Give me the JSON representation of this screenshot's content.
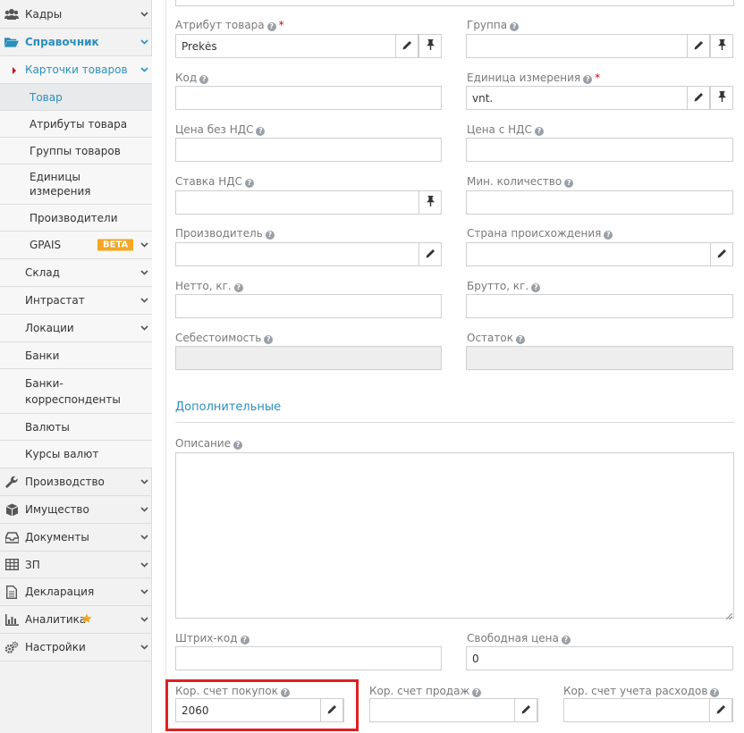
{
  "sidebar": {
    "sections": [
      {
        "label": "Кадры",
        "icon": "users-icon"
      },
      {
        "label": "Справочник",
        "icon": "folder-open-icon"
      },
      {
        "label": "Карточки товаров"
      },
      {
        "label": "Товар"
      },
      {
        "label": "Атрибуты товара"
      },
      {
        "label": "Группы товаров"
      },
      {
        "label": "Единицы измерения"
      },
      {
        "label": "Производители"
      },
      {
        "label": "GPAIS",
        "badge": "BETA"
      },
      {
        "label": "Склад"
      },
      {
        "label": "Интрастат"
      },
      {
        "label": "Локации"
      },
      {
        "label": "Банки"
      },
      {
        "label": "Банки-корреспонденты"
      },
      {
        "label": "Валюты"
      },
      {
        "label": "Курсы валют"
      },
      {
        "label": "Производство",
        "icon": "wrench-icon"
      },
      {
        "label": "Имущество",
        "icon": "cube-icon"
      },
      {
        "label": "Документы",
        "icon": "inbox-icon"
      },
      {
        "label": "ЗП",
        "icon": "table-icon"
      },
      {
        "label": "Декларация",
        "icon": "document-icon"
      },
      {
        "label": "Аналитика",
        "icon": "bar-chart-icon"
      },
      {
        "label": "Настройки",
        "icon": "gears-icon"
      }
    ]
  },
  "form": {
    "attribute": {
      "label": "Атрибут товара",
      "value": "Prekės"
    },
    "group": {
      "label": "Группа",
      "value": ""
    },
    "code": {
      "label": "Код",
      "value": ""
    },
    "unit": {
      "label": "Единица измерения",
      "value": "vnt."
    },
    "price_no_vat": {
      "label": "Цена без НДС",
      "value": ""
    },
    "price_vat": {
      "label": "Цена с НДС",
      "value": ""
    },
    "vat_rate": {
      "label": "Ставка НДС",
      "value": ""
    },
    "min_qty": {
      "label": "Мин. количество",
      "value": ""
    },
    "manufacturer": {
      "label": "Производитель",
      "value": ""
    },
    "country": {
      "label": "Страна происхождения",
      "value": ""
    },
    "net": {
      "label": "Нетто, кг.",
      "value": ""
    },
    "gross": {
      "label": "Брутто, кг.",
      "value": ""
    },
    "cost": {
      "label": "Себестоимость",
      "value": ""
    },
    "stock": {
      "label": "Остаток",
      "value": ""
    },
    "section_title": "Дополнительные",
    "description": {
      "label": "Описание",
      "value": ""
    },
    "barcode": {
      "label": "Штрих-код",
      "value": ""
    },
    "free_price": {
      "label": "Свободная цена",
      "value": "0"
    },
    "purchase_account": {
      "label": "Кор. счет покупок",
      "value": "2060"
    },
    "sales_account": {
      "label": "Кор. счет продаж",
      "value": ""
    },
    "expense_account": {
      "label": "Кор. счет учета расходов",
      "value": ""
    }
  },
  "colors": {
    "accent": "#2a8fbd",
    "highlight": "#e02020",
    "badge": "#f5a623",
    "required": "#d0021b"
  }
}
